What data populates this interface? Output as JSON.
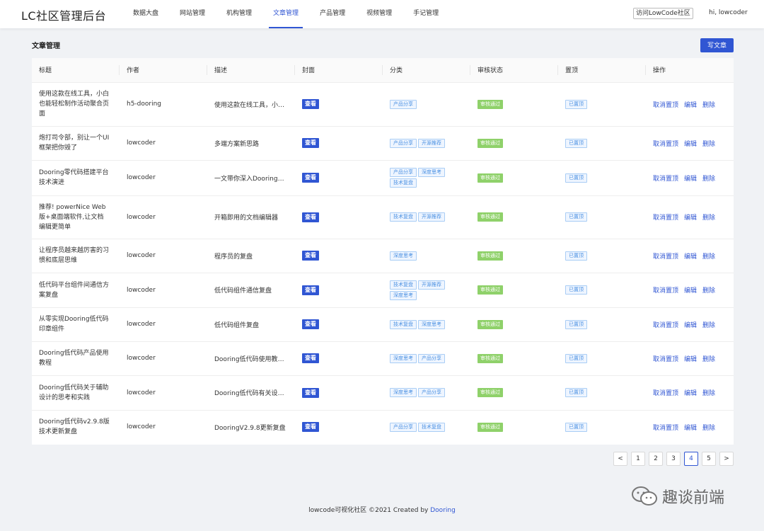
{
  "app": {
    "title": "LC社区管理后台"
  },
  "nav": [
    {
      "label": "数据大盘",
      "active": false
    },
    {
      "label": "网站管理",
      "active": false
    },
    {
      "label": "机构管理",
      "active": false
    },
    {
      "label": "文章管理",
      "active": true
    },
    {
      "label": "产品管理",
      "active": false
    },
    {
      "label": "视频管理",
      "active": false
    },
    {
      "label": "手记管理",
      "active": false
    }
  ],
  "header": {
    "visit_label": "访问LowCode社区",
    "user_label": "hi, lowcoder"
  },
  "page": {
    "title": "文章管理",
    "write_label": "写文章"
  },
  "table": {
    "columns": [
      "标题",
      "作者",
      "描述",
      "封面",
      "分类",
      "审核状态",
      "置顶",
      "操作"
    ],
    "view_label": "查看",
    "ops": [
      "取消置顶",
      "编辑",
      "删除"
    ],
    "rows": [
      {
        "title": "使用这款在线工具，小白也能轻松制作活动聚合页面",
        "author": "h5-dooring",
        "desc": "使用这款在线工具，小白...",
        "tags": [
          "产品分享"
        ],
        "status": "审核通过",
        "top": "已置顶"
      },
      {
        "title": "炮打司令部，别让一个UI框架把你毁了",
        "author": "lowcoder",
        "desc": "多端方案新思路",
        "tags": [
          "产品分享",
          "开源推荐"
        ],
        "status": "审核通过",
        "top": "已置顶"
      },
      {
        "title": "Dooring零代码搭建平台技术演进",
        "author": "lowcoder",
        "desc": "一文带你深入Dooring技...",
        "tags": [
          "产品分享",
          "深度思考",
          "技术复盘"
        ],
        "status": "审核通过",
        "top": "已置顶"
      },
      {
        "title": "推荐! powerNice Web版+桌面端软件,让文档编辑更简单",
        "author": "lowcoder",
        "desc": "开箱即用的文档编辑器",
        "tags": [
          "技术复盘",
          "开源推荐"
        ],
        "status": "审核通过",
        "top": "已置顶"
      },
      {
        "title": "让程序员越来越厉害的习惯和底层思维",
        "author": "lowcoder",
        "desc": "程序员的复盘",
        "tags": [
          "深度思考"
        ],
        "status": "审核通过",
        "top": "已置顶"
      },
      {
        "title": "低代码平台组件间通信方案复盘",
        "author": "lowcoder",
        "desc": "低代码组件通信复盘",
        "tags": [
          "技术复盘",
          "开源推荐",
          "深度思考"
        ],
        "status": "审核通过",
        "top": "已置顶"
      },
      {
        "title": "从零实现Dooring低代码印章组件",
        "author": "lowcoder",
        "desc": "低代码组件复盘",
        "tags": [
          "技术复盘",
          "深度思考"
        ],
        "status": "审核通过",
        "top": "已置顶"
      },
      {
        "title": "Dooring低代码产品使用教程",
        "author": "lowcoder",
        "desc": "Dooring低代码使用教程...",
        "tags": [
          "深度思考",
          "产品分享"
        ],
        "status": "审核通过",
        "top": "已置顶"
      },
      {
        "title": "Dooring低代码关于辅助设计的思考和实践",
        "author": "lowcoder",
        "desc": "Dooring低代码有关设计...",
        "tags": [
          "深度思考",
          "产品分享"
        ],
        "status": "审核通过",
        "top": "已置顶"
      },
      {
        "title": "Dooring低代码v2.9.8版技术更新复盘",
        "author": "lowcoder",
        "desc": "DooringV2.9.8更新复盘",
        "tags": [
          "产品分享",
          "技术复盘"
        ],
        "status": "审核通过",
        "top": "已置顶"
      }
    ]
  },
  "pagination": {
    "prev": "<",
    "next": ">",
    "pages": [
      "1",
      "2",
      "3",
      "4",
      "5"
    ],
    "current": "4"
  },
  "footer": {
    "text": "lowcode可视化社区 ©2021 Created by ",
    "link": "Dooring"
  },
  "watermark": {
    "text": "趣谈前端",
    "icon": "wechat-icon"
  }
}
